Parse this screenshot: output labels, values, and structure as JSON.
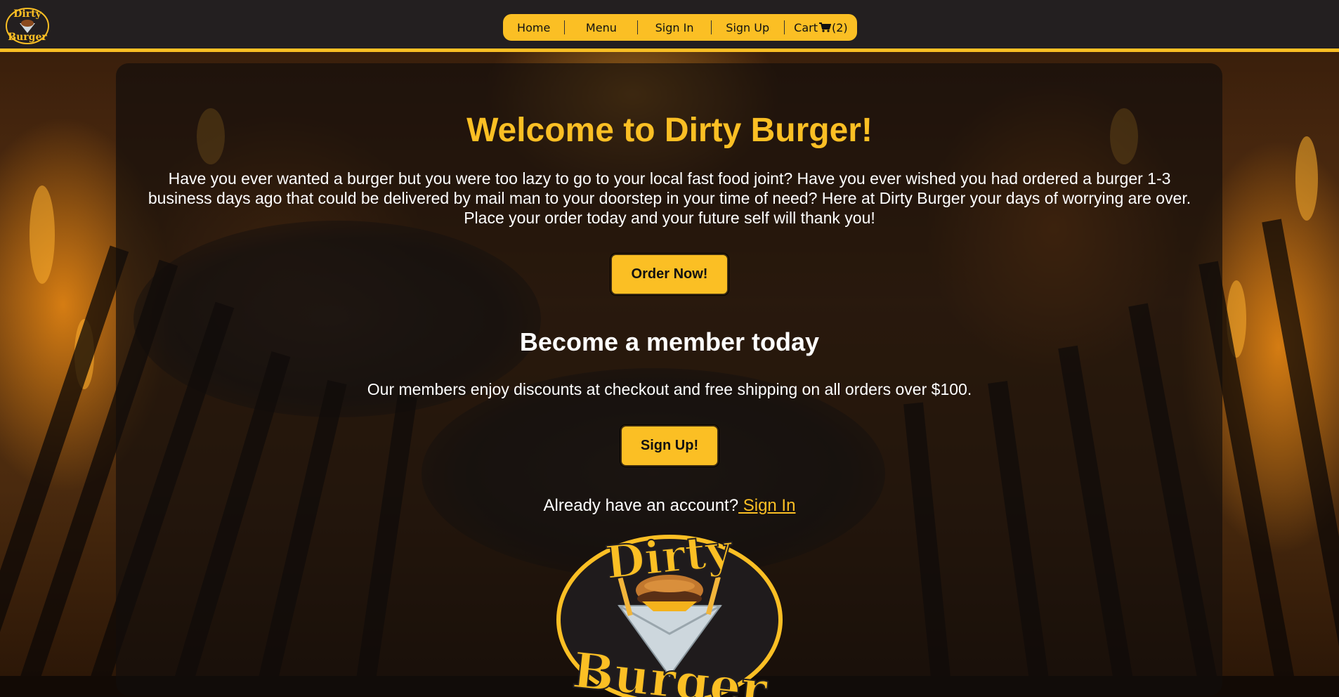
{
  "header": {
    "logo_alt": "Dirty Burger",
    "nav": [
      {
        "label": "Home"
      },
      {
        "label": "Menu"
      },
      {
        "label": "Sign In"
      },
      {
        "label": "Sign Up"
      }
    ],
    "cart_label": "Cart",
    "cart_count": "(2)"
  },
  "main": {
    "title": "Welcome to Dirty Burger!",
    "intro": "Have you ever wanted a burger but you were too lazy to go to your local fast food joint? Have you ever wished you had ordered a burger 1-3 business days ago that could be delivered by mail man to your doorstep in your time of need? Here at Dirty Burger your days of worrying are over. Place your order today and your future self will thank you!",
    "order_button": "Order Now!",
    "member_title": "Become a member today",
    "member_text": "Our members enjoy discounts at checkout and free shipping on all orders over $100.",
    "signup_button": "Sign Up!",
    "account_prompt": "Already have an account?",
    "signin_link": " Sign In"
  },
  "logo": {
    "line1": "Dirty",
    "line2": "Burger"
  },
  "colors": {
    "accent": "#fbbf24",
    "header_bg": "#231f20",
    "text": "#ffffff"
  }
}
